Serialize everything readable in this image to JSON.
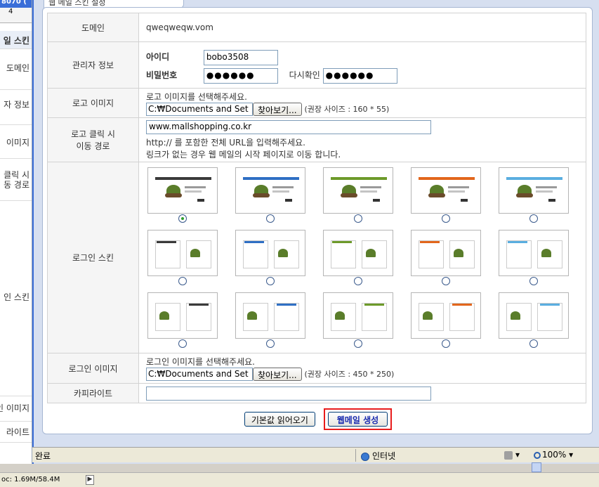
{
  "bg_app": {
    "title": "8070 (",
    "ruler": "4",
    "header": "일 스킨",
    "rows": [
      "도메인",
      "자 정보",
      "이미지",
      "클릭 시",
      "동 경로",
      "인 스킨",
      "인 이미지",
      "라이트"
    ]
  },
  "tab_title": "웹 메일 스킨 설정",
  "form": {
    "domain": {
      "label": "도메인",
      "value": "qweqweqw.vom"
    },
    "admin": {
      "label": "관리자 정보",
      "id_label": "아이디",
      "id_value": "bobo3508",
      "pw_label": "비밀번호",
      "pw_value": "●●●●●●",
      "confirm_label": "다시확인",
      "confirm_value": "●●●●●●"
    },
    "logo_image": {
      "label": "로고 이미지",
      "instruction": "로고 이미지를 선택해주세요.",
      "file_value": "C:₩Documents and Set",
      "browse_label": "찾아보기...",
      "hint": "(권장 사이즈 : 160 * 55)"
    },
    "logo_link": {
      "label_line1": "로고 클릭 시",
      "label_line2": "이동 경로",
      "value": "www.mallshopping.co.kr",
      "help1": "http:// 를 포함한 전체 URL을 입력해주세요.",
      "help2": "링크가 없는 경우 웹 메일의 시작 페이지로 이동 합니다."
    },
    "login_skin": {
      "label": "로그인 스킨",
      "selected_index": 0,
      "colors": [
        "#3a3a3a",
        "#2f6fc4",
        "#6d9a2a",
        "#e2661c",
        "#5aaee0"
      ]
    },
    "login_image": {
      "label": "로그인 이미지",
      "instruction": "로그인 이미지를 선택해주세요.",
      "file_value": "C:₩Documents and Set",
      "browse_label": "찾아보기...",
      "hint": "(권장 사이즈 : 450 * 250)"
    },
    "copyright": {
      "label": "카피라이트",
      "value": ""
    }
  },
  "actions": {
    "default_label": "기본값 읽어오기",
    "create_label": "웹메일 생성"
  },
  "statusbar": {
    "done": "완료",
    "zone": "인터넷",
    "zoom": "100%"
  },
  "osbar": {
    "memory": "oc: 1.69M/58.4M"
  }
}
